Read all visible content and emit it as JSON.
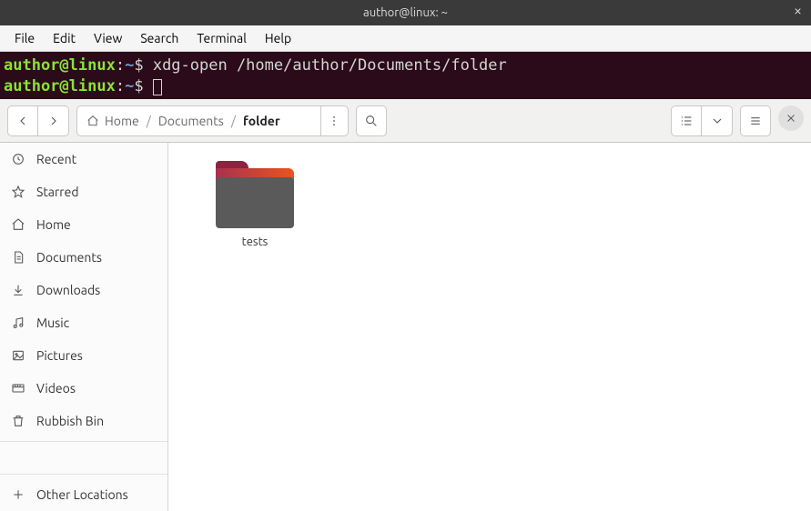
{
  "titlebar": {
    "title": "author@linux: ~"
  },
  "menubar": {
    "items": [
      "File",
      "Edit",
      "View",
      "Search",
      "Terminal",
      "Help"
    ]
  },
  "terminal": {
    "user": "author@linux",
    "path": "~",
    "prompt": "$",
    "command": "xdg-open /home/author/Documents/folder"
  },
  "nautilus": {
    "breadcrumb": {
      "home": "Home",
      "crumbs": [
        "Documents"
      ],
      "current": "folder"
    },
    "sidebar": {
      "recent": "Recent",
      "starred": "Starred",
      "home": "Home",
      "documents": "Documents",
      "downloads": "Downloads",
      "music": "Music",
      "pictures": "Pictures",
      "videos": "Videos",
      "trash": "Rubbish Bin",
      "other": "Other Locations"
    },
    "content": {
      "items": [
        {
          "name": "tests",
          "type": "folder"
        }
      ]
    }
  }
}
